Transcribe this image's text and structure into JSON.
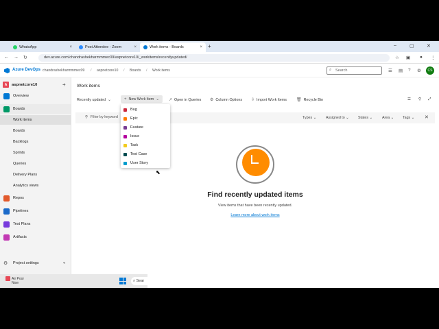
{
  "browser": {
    "tabs": [
      {
        "label": "WhatsApp",
        "color": "#25d366"
      },
      {
        "label": "Post Attendee - Zoom",
        "color": "#2d8cff"
      },
      {
        "label": "Work items - Boards",
        "color": "#0078d4"
      }
    ],
    "url": "dev.azure.com/chandrashekharmmmec09/aspnetcore10/_workitems/recentlyupdated/"
  },
  "header": {
    "product": "Azure DevOps",
    "breadcrumbs": [
      "chandrashekharmmmec09",
      "aspnetcore10",
      "Boards",
      "Work items"
    ],
    "search_placeholder": "Search",
    "avatar_initials": "CS"
  },
  "sidebar": {
    "project_initial": "A",
    "project_name": "aspnetcore10",
    "items": [
      {
        "label": "Overview",
        "color": "#0078d4"
      },
      {
        "label": "Boards",
        "color": "#009966"
      },
      {
        "label": "Work items"
      },
      {
        "label": "Boards"
      },
      {
        "label": "Backlogs"
      },
      {
        "label": "Sprints"
      },
      {
        "label": "Queries"
      },
      {
        "label": "Delivery Plans"
      },
      {
        "label": "Analytics views"
      },
      {
        "label": "Repos",
        "color": "#e25a2c"
      },
      {
        "label": "Pipelines",
        "color": "#1b6ac9"
      },
      {
        "label": "Test Plans",
        "color": "#773adc"
      },
      {
        "label": "Artifacts",
        "color": "#c239b3"
      }
    ],
    "settings_label": "Project settings"
  },
  "main": {
    "title": "Work items",
    "toolbar": {
      "view": "Recently updated",
      "new_item": "New Work Item",
      "open_queries": "Open in Queries",
      "column_options": "Column Options",
      "import": "Import Work Items",
      "recycle": "Recycle Bin"
    },
    "filter": {
      "keyword_placeholder": "Filter by keyword",
      "dropdowns": [
        "Types",
        "Assigned to",
        "States",
        "Area",
        "Tags"
      ]
    },
    "menu": [
      {
        "label": "Bug",
        "color": "#cc293d"
      },
      {
        "label": "Epic",
        "color": "#ff7b00"
      },
      {
        "label": "Feature",
        "color": "#773b93"
      },
      {
        "label": "Issue",
        "color": "#b4009e"
      },
      {
        "label": "Task",
        "color": "#f2cb1d"
      },
      {
        "label": "Test Case",
        "color": "#004b50"
      },
      {
        "label": "User Story",
        "color": "#009ccc"
      }
    ],
    "empty": {
      "title": "Find recently updated items",
      "subtitle": "View items that have been recently updated.",
      "link": "Learn more about work items"
    }
  },
  "taskbar": {
    "weather_title": "Air Poor",
    "weather_sub": "Now",
    "search": "Sear"
  }
}
